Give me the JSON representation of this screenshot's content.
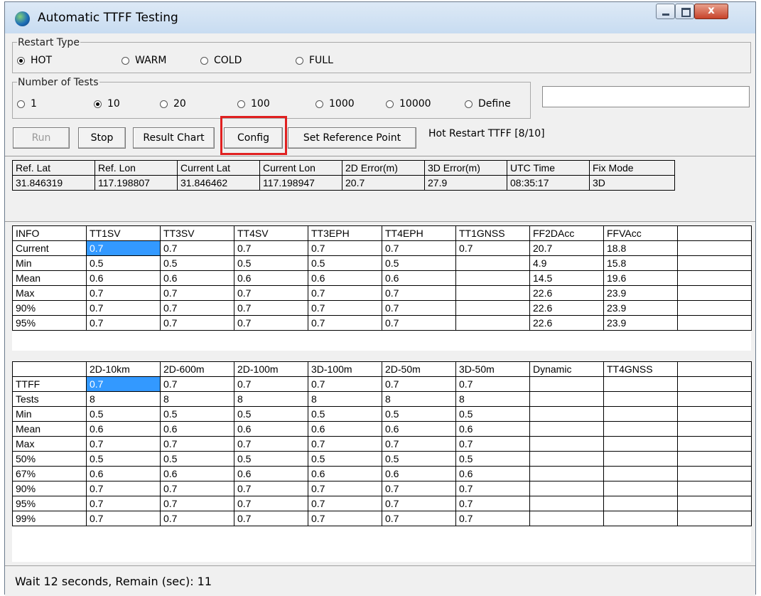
{
  "window": {
    "title": "Automatic TTFF Testing",
    "close_glyph": "x"
  },
  "restart_type": {
    "legend": "Restart Type",
    "options": [
      {
        "label": "HOT",
        "selected": true
      },
      {
        "label": "WARM",
        "selected": false
      },
      {
        "label": "COLD",
        "selected": false
      },
      {
        "label": "FULL",
        "selected": false
      }
    ]
  },
  "number_of_tests": {
    "legend": "Number of Tests",
    "options": [
      {
        "label": "1",
        "selected": false
      },
      {
        "label": "10",
        "selected": true
      },
      {
        "label": "20",
        "selected": false
      },
      {
        "label": "100",
        "selected": false
      },
      {
        "label": "1000",
        "selected": false
      },
      {
        "label": "10000",
        "selected": false
      },
      {
        "label": "Define",
        "selected": false
      }
    ],
    "define_value": ""
  },
  "toolbar": {
    "run": "Run",
    "stop": "Stop",
    "result_chart": "Result Chart",
    "config": "Config",
    "set_reference_point": "Set Reference Point",
    "status": "Hot Restart TTFF [8/10]"
  },
  "position": {
    "headers": [
      "Ref. Lat",
      "Ref. Lon",
      "Current Lat",
      "Current Lon",
      "2D Error(m)",
      "3D Error(m)",
      "UTC Time",
      "Fix Mode"
    ],
    "values": [
      "31.846319",
      "117.198807",
      "31.846462",
      "117.198947",
      "20.7",
      "27.9",
      "08:35:17",
      "3D"
    ]
  },
  "info_table": {
    "headers": [
      "INFO",
      "TT1SV",
      "TT3SV",
      "TT4SV",
      "TT3EPH",
      "TT4EPH",
      "TT1GNSS",
      "FF2DAcc",
      "FFVAcc",
      ""
    ],
    "rows": [
      [
        "Current",
        "0.7",
        "0.7",
        "0.7",
        "0.7",
        "0.7",
        "0.7",
        "20.7",
        "18.8",
        ""
      ],
      [
        "Min",
        "0.5",
        "0.5",
        "0.5",
        "0.5",
        "0.5",
        "",
        "4.9",
        "15.8",
        ""
      ],
      [
        "Mean",
        "0.6",
        "0.6",
        "0.6",
        "0.6",
        "0.6",
        "",
        "14.5",
        "19.6",
        ""
      ],
      [
        "Max",
        "0.7",
        "0.7",
        "0.7",
        "0.7",
        "0.7",
        "",
        "22.6",
        "23.9",
        ""
      ],
      [
        "90%",
        "0.7",
        "0.7",
        "0.7",
        "0.7",
        "0.7",
        "",
        "22.6",
        "23.9",
        ""
      ],
      [
        "95%",
        "0.7",
        "0.7",
        "0.7",
        "0.7",
        "0.7",
        "",
        "22.6",
        "23.9",
        ""
      ]
    ]
  },
  "ttff_table": {
    "headers": [
      "",
      "2D-10km",
      "2D-600m",
      "2D-100m",
      "3D-100m",
      "2D-50m",
      "3D-50m",
      "Dynamic",
      "TT4GNSS",
      ""
    ],
    "rows": [
      [
        "TTFF",
        "0.7",
        "0.7",
        "0.7",
        "0.7",
        "0.7",
        "0.7",
        "",
        "",
        ""
      ],
      [
        "Tests",
        "8",
        "8",
        "8",
        "8",
        "8",
        "8",
        "",
        "",
        ""
      ],
      [
        "Min",
        "0.5",
        "0.5",
        "0.5",
        "0.5",
        "0.5",
        "0.5",
        "",
        "",
        ""
      ],
      [
        "Mean",
        "0.6",
        "0.6",
        "0.6",
        "0.6",
        "0.6",
        "0.6",
        "",
        "",
        ""
      ],
      [
        "Max",
        "0.7",
        "0.7",
        "0.7",
        "0.7",
        "0.7",
        "0.7",
        "",
        "",
        ""
      ],
      [
        "50%",
        "0.5",
        "0.5",
        "0.5",
        "0.5",
        "0.5",
        "0.5",
        "",
        "",
        ""
      ],
      [
        "67%",
        "0.6",
        "0.6",
        "0.6",
        "0.6",
        "0.6",
        "0.6",
        "",
        "",
        ""
      ],
      [
        "90%",
        "0.7",
        "0.7",
        "0.7",
        "0.7",
        "0.7",
        "0.7",
        "",
        "",
        ""
      ],
      [
        "95%",
        "0.7",
        "0.7",
        "0.7",
        "0.7",
        "0.7",
        "0.7",
        "",
        "",
        ""
      ],
      [
        "99%",
        "0.7",
        "0.7",
        "0.7",
        "0.7",
        "0.7",
        "0.7",
        "",
        "",
        ""
      ]
    ]
  },
  "statusbar": {
    "text": "Wait 12 seconds, Remain (sec): 11"
  },
  "colors": {
    "highlight": "#e02020",
    "selection": "#3399ff"
  }
}
